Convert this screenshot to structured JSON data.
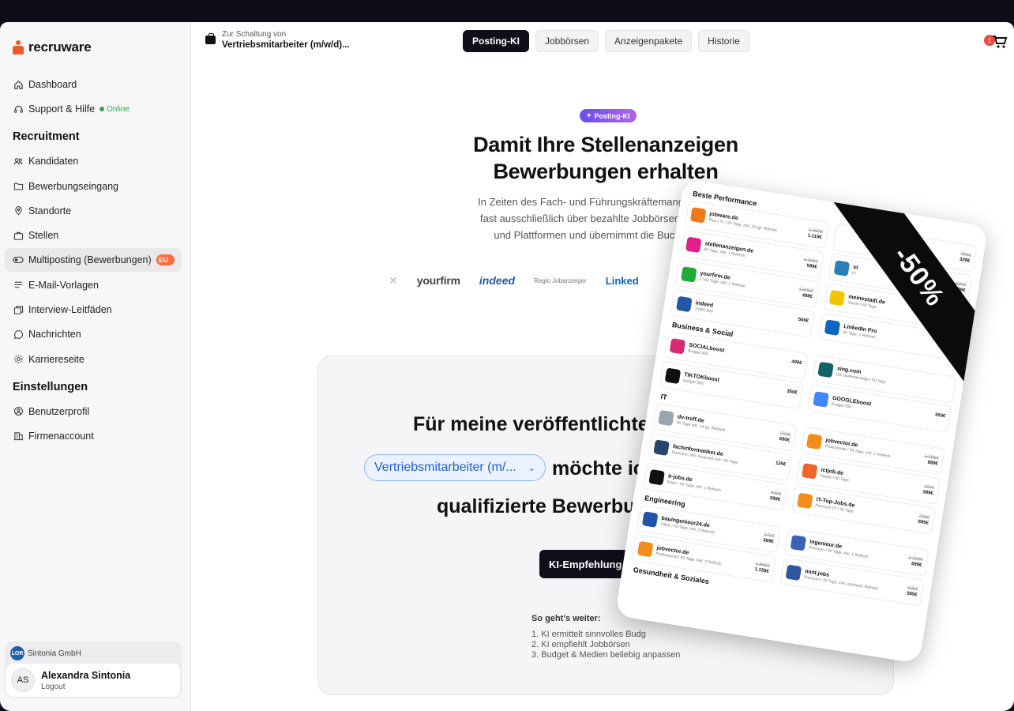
{
  "brand": {
    "name": "recruware"
  },
  "sidebar": {
    "top_items": [
      {
        "label": "Dashboard"
      },
      {
        "label": "Support & Hilfe",
        "status": "Online"
      }
    ],
    "recruitment_title": "Recruitment",
    "recruitment_items": [
      {
        "label": "Kandidaten"
      },
      {
        "label": "Bewerbungseingang"
      },
      {
        "label": "Standorte"
      },
      {
        "label": "Stellen"
      },
      {
        "label": "Multiposting (Bewerbungen)",
        "badge": "EU"
      },
      {
        "label": "E-Mail-Vorlagen"
      },
      {
        "label": "Interview-Leitfäden"
      },
      {
        "label": "Nachrichten"
      },
      {
        "label": "Karriereseite"
      }
    ],
    "settings_title": "Einstellungen",
    "settings_items": [
      {
        "label": "Benutzerprofil"
      },
      {
        "label": "Firmenaccount"
      }
    ],
    "account": {
      "company": "Sintonia GmbH",
      "company_logo_text": "LOR",
      "initials": "AS",
      "user": "Alexandra Sintonia",
      "logout": "Logout"
    }
  },
  "topbar": {
    "context_label": "Zur Schaltung von",
    "context_title": "Vertriebsmitarbeiter (m/w/d)...",
    "tabs": [
      {
        "label": "Posting-KI",
        "active": true
      },
      {
        "label": "Jobbörsen"
      },
      {
        "label": "Anzeigenpakete"
      },
      {
        "label": "Historie"
      }
    ],
    "cart_count": "1"
  },
  "hero": {
    "pill": "Posting-KI",
    "title": "Damit Ihre Stellenanzeigen Bewerbungen erhalten",
    "subtitle_lines": [
      "In Zeiten des Fach- und Führungskräftemangels entsteh",
      "fast ausschließlich über bezahlte Jobbörsen. recruware",
      "und Plattformen und übernimmt die Buchung und"
    ],
    "partners": [
      "yourfirm",
      "indeed",
      "Regio Jobanzeiger",
      "Linked"
    ]
  },
  "card": {
    "line1": "Für meine veröffentlichte",
    "job_select_value": "Vertriebsmitarbeiter (m/...",
    "line2": "möchte ich",
    "line3": "qualifizierte Bewerbu",
    "button": "KI-Empfehlung bek",
    "steps_title": "So geht's weiter:",
    "steps": [
      "1. KI ermittelt sinnvolles Budg",
      "2. KI empfiehlt Jobbörsen",
      "3. Budget & Medien beliebig anpassen"
    ]
  },
  "promo": {
    "ribbon": "-50%",
    "sections": [
      {
        "title": "Beste Performance",
        "offers": [
          {
            "name": "jobware.de",
            "desc": "Plus / XL / 60 Tage, inkl. 15-tgl. Refresh",
            "old": "1.950€",
            "price": "1.119€",
            "color": "#f07a1a"
          },
          {
            "name": "",
            "desc": "",
            "old": "795€",
            "price": "329€",
            "color": "#ffffff"
          },
          {
            "name": "stellenanzeigen.de",
            "desc": "60 Tage, inkl. 1 Refresh",
            "old": "1.395€",
            "price": "599€",
            "color": "#e0218a"
          },
          {
            "name": "st",
            "desc": "Pr",
            "old": "1.699€",
            "price": "1.299€",
            "color": "#2a7fb8"
          },
          {
            "name": "yourfirm.de",
            "desc": "L / 60 Tage, inkl. 1 Refresh",
            "old": "1.095€",
            "price": "499€",
            "color": "#1faa3a"
          },
          {
            "name": "meinestadt.de",
            "desc": "Starter / 60 Tage",
            "old": "",
            "price": "",
            "color": "#f5c400"
          },
          {
            "name": "indeed",
            "desc": "Traffic 500",
            "old": "",
            "price": "500€",
            "color": "#2557a7"
          },
          {
            "name": "LinkedIn Pro",
            "desc": "30 Tage, 1 Refresh",
            "old": "",
            "price": "",
            "color": "#0a66c2"
          }
        ]
      },
      {
        "title": "Business & Social",
        "offers": [
          {
            "name": "SOCIALboost",
            "desc": "Budget 400",
            "old": "",
            "price": "400€",
            "color": "#d62976"
          },
          {
            "name": "xing.com",
            "desc": "Die Stellenanzeige / 60 Tage",
            "old": "",
            "price": "",
            "color": "#126567"
          },
          {
            "name": "TIKTOKboost",
            "desc": "Budget 350",
            "old": "",
            "price": "350€",
            "color": "#111111"
          },
          {
            "name": "GOOGLEboost",
            "desc": "Budget 300",
            "old": "",
            "price": "300€",
            "color": "#4285f4"
          }
        ]
      },
      {
        "title": "IT",
        "offers": [
          {
            "name": "dv-treff.de",
            "desc": "30 Tage inkl. 14-tgl. Refresh",
            "old": "790€",
            "price": "690€",
            "color": "#9aa5b1"
          },
          {
            "name": "jobvector.de",
            "desc": "Professional / 30 Tage, inkl. 1 Refresh",
            "old": "1.195€",
            "price": "999€",
            "color": "#f28c1b"
          },
          {
            "name": "fachinformatiker.de",
            "desc": "Premium, inkl. Featured Job / 60 Tage",
            "old": "",
            "price": "125€",
            "color": "#27466b"
          },
          {
            "name": "ictjob.de",
            "desc": "Starter / 60 Tage",
            "old": "499€",
            "price": "399€",
            "color": "#f0642a"
          },
          {
            "name": "it-jobs.de",
            "desc": "Basic / 60 Tage, inkl. 1 Refresh",
            "old": "499€",
            "price": "299€",
            "color": "#111111"
          },
          {
            "name": "IT-Top-Jobs.de",
            "desc": "Premium 07 / 30 Tage",
            "old": "795€",
            "price": "695€",
            "color": "#f28c1b"
          }
        ]
      },
      {
        "title": "Engineering",
        "offers": [
          {
            "name": "bauingenieur24.de",
            "desc": "Silber / 60 Tage, inkl. 3 Refresh",
            "old": "675€",
            "price": "599€",
            "color": "#2255aa"
          },
          {
            "name": "ingenieur.de",
            "desc": "Premium / 60 Tage, inkl. 1 Refresh",
            "old": "1.195€",
            "price": "699€",
            "color": "#3a63b8"
          },
          {
            "name": "jobvector.de",
            "desc": "Professional / 60 Tage, inkl. 3 Refresh",
            "old": "1.555€",
            "price": "1.155€",
            "color": "#f28c1b"
          },
          {
            "name": "mint.jobs",
            "desc": "Premium / 30 Tage, inkl. wöchentl. Refresh",
            "old": "685€",
            "price": "585€",
            "color": "#3056a0"
          }
        ]
      },
      {
        "title": "Gesundheit & Soziales",
        "offers": []
      }
    ]
  },
  "colors": {
    "accent": "#0f0f1a",
    "brand": "#f05a28",
    "link": "#1c5fcf"
  }
}
